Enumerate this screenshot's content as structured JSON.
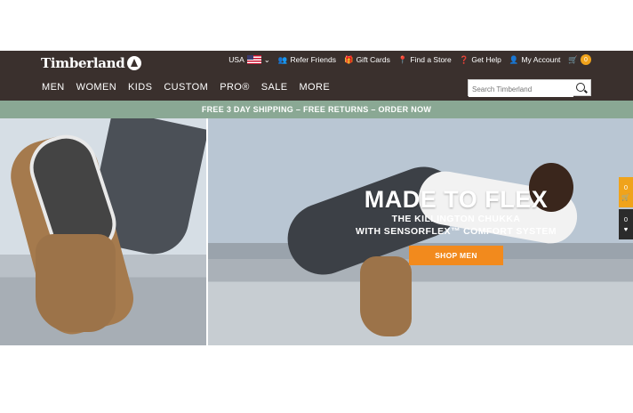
{
  "header": {
    "logo_text": "Timberland",
    "country": "USA",
    "utility_links": [
      "Refer Friends",
      "Gift Cards",
      "Find a Store",
      "Get Help",
      "My Account"
    ],
    "cart_count": "0"
  },
  "nav": {
    "items": [
      "MEN",
      "WOMEN",
      "KIDS",
      "CUSTOM",
      "PRO®",
      "SALE",
      "MORE"
    ]
  },
  "search": {
    "placeholder": "Search Timberland"
  },
  "promo": {
    "text": "FREE 3 DAY SHIPPING – FREE RETURNS – ORDER NOW"
  },
  "hero": {
    "title": "MADE TO FLEX",
    "subtitle_line1": "THE KILLINGTON CHUKKA",
    "subtitle_line2": "WITH SENSORFLEX™ COMFORT SYSTEM",
    "button_label": "SHOP MEN"
  },
  "side_widgets": {
    "cart_count": "0",
    "wishlist_count": "0"
  },
  "colors": {
    "header_bg": "#3a302d",
    "promo_bg": "#8aa894",
    "accent": "#f28a1d",
    "badge": "#f0a31b"
  }
}
